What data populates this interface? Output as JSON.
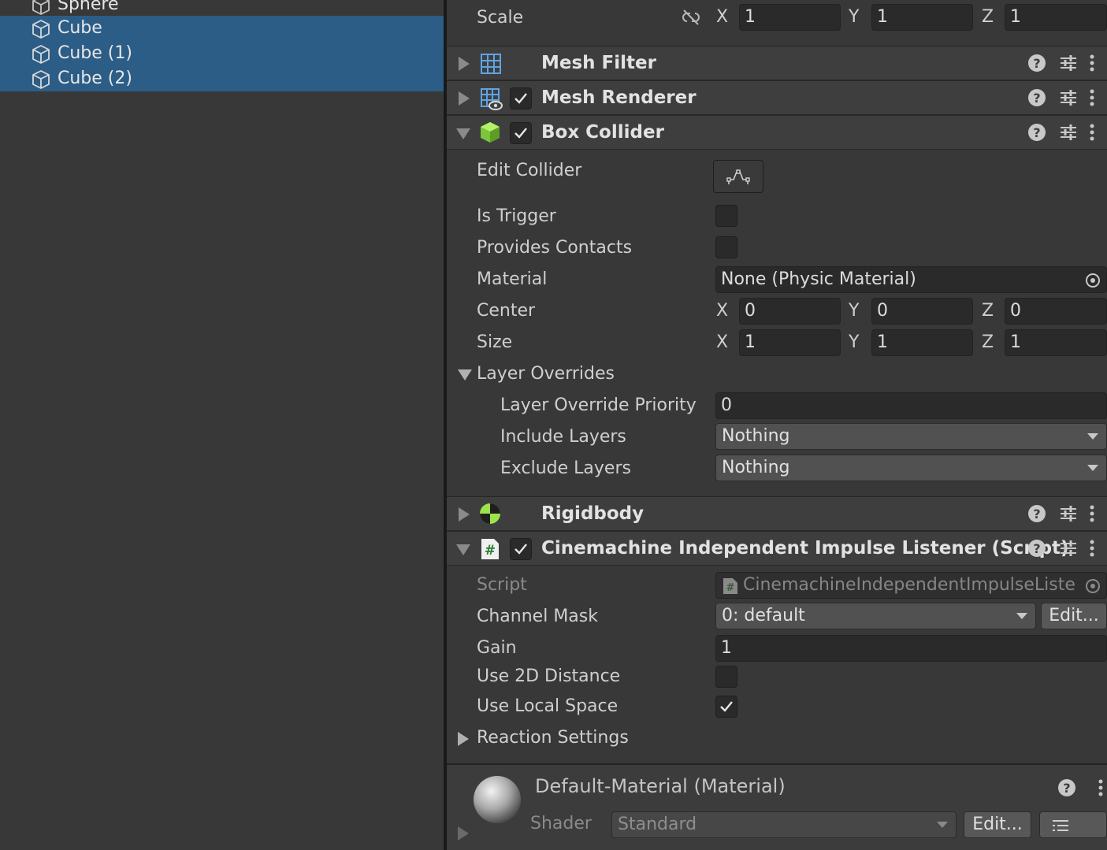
{
  "hierarchy": {
    "items": [
      {
        "label": "Sphere",
        "selected": false
      },
      {
        "label": "Cube",
        "selected": true
      },
      {
        "label": "Cube (1)",
        "selected": true
      },
      {
        "label": "Cube (2)",
        "selected": true
      }
    ]
  },
  "transform": {
    "scale_label": "Scale",
    "scale": {
      "x": "1",
      "y": "1",
      "z": "1"
    }
  },
  "axes": {
    "x": "X",
    "y": "Y",
    "z": "Z"
  },
  "components": {
    "mesh_filter": {
      "title": "Mesh Filter"
    },
    "mesh_renderer": {
      "title": "Mesh Renderer",
      "enabled": true
    },
    "box_collider": {
      "title": "Box Collider",
      "enabled": true,
      "edit_collider_label": "Edit Collider",
      "is_trigger_label": "Is Trigger",
      "is_trigger": false,
      "provides_contacts_label": "Provides Contacts",
      "provides_contacts": false,
      "material_label": "Material",
      "material_value": "None (Physic Material)",
      "center_label": "Center",
      "center": {
        "x": "0",
        "y": "0",
        "z": "0"
      },
      "size_label": "Size",
      "size": {
        "x": "1",
        "y": "1",
        "z": "1"
      },
      "layer_overrides_label": "Layer Overrides",
      "layer_override_priority_label": "Layer Override Priority",
      "layer_override_priority": "0",
      "include_layers_label": "Include Layers",
      "include_layers": "Nothing",
      "exclude_layers_label": "Exclude Layers",
      "exclude_layers": "Nothing"
    },
    "rigidbody": {
      "title": "Rigidbody"
    },
    "impulse_listener": {
      "title": "Cinemachine Independent Impulse Listener (Script)",
      "enabled": true,
      "script_label": "Script",
      "script_value": "CinemachineIndependentImpulseListe",
      "channel_mask_label": "Channel Mask",
      "channel_mask": "0: default",
      "edit_button": "Edit...",
      "gain_label": "Gain",
      "gain": "1",
      "use_2d_distance_label": "Use 2D Distance",
      "use_2d_distance": false,
      "use_local_space_label": "Use Local Space",
      "use_local_space": true,
      "reaction_settings_label": "Reaction Settings"
    },
    "material": {
      "title": "Default-Material (Material)",
      "shader_label": "Shader",
      "shader_value": "Standard",
      "edit_button": "Edit..."
    }
  },
  "icons": {
    "hierarchy_item": "cube-outline-icon",
    "mesh_filter": "grid-icon",
    "mesh_renderer": "grid-eye-icon",
    "box_collider": "green-cube-icon",
    "rigidbody": "rigidbody-ball-icon",
    "script": "script-hash-icon",
    "help": "help-icon",
    "presets": "sliders-icon",
    "more": "kebab-menu-icon",
    "object_picker": "target-icon",
    "material_preview": "sphere-preview-icon"
  },
  "colors": {
    "background": "#383838",
    "selection": "#2c5d87",
    "field": "#2a2a2a",
    "header": "#3e3e3e",
    "accent_icon_blue": "#5fa3e6",
    "collider_green": "#9de34a"
  }
}
